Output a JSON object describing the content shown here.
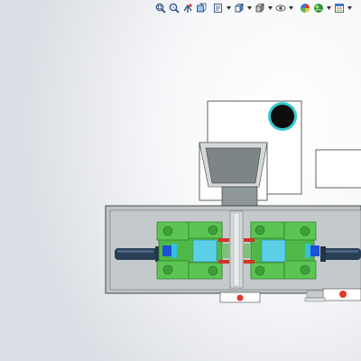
{
  "toolbar": {
    "buttons": [
      {
        "icon": "zoom-to-fit-icon",
        "dropdown": false
      },
      {
        "icon": "zoom-to-area-icon",
        "dropdown": false
      },
      {
        "icon": "previous-view-icon",
        "dropdown": false
      },
      {
        "icon": "section-view-icon",
        "dropdown": false
      },
      {
        "icon": "dynamic-annotation-views-icon",
        "dropdown": true
      },
      {
        "icon": "view-orientation-icon",
        "dropdown": true
      },
      {
        "icon": "display-style-icon",
        "dropdown": true
      },
      {
        "icon": "hide-show-items-icon",
        "dropdown": true
      },
      {
        "icon": "edit-appearance-icon",
        "dropdown": false
      },
      {
        "icon": "apply-scene-icon",
        "dropdown": true
      },
      {
        "icon": "view-settings-icon",
        "dropdown": true
      }
    ]
  },
  "colors": {
    "machine_green": "#4fb847",
    "machine_green_dark": "#2c7a2a",
    "cyan_block": "#5ccfe8",
    "blue_block": "#1d4fd8",
    "motor_dark": "#2a3f55",
    "red_indicator": "#e0382a",
    "frame_gray": "#b7bcbf",
    "hopper_gray": "#7c8488",
    "enclosure_white": "#ffffff"
  }
}
